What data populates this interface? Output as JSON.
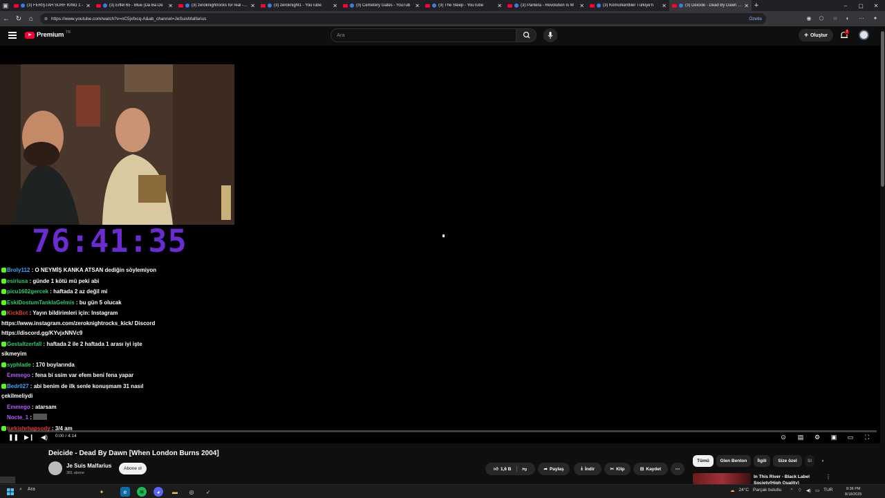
{
  "browser": {
    "tabs": [
      {
        "title": "(3) FERİŞTAH SURF KING 1 -",
        "active": false
      },
      {
        "title": "(3) Eiffel 65 - Blue (Da Ba De",
        "active": false
      },
      {
        "title": "(3) zeroknightrocks for real - You",
        "active": false
      },
      {
        "title": "(3) zeroknight1 - YouTube",
        "active": false
      },
      {
        "title": "(3) Cemetery Gates - YouTub",
        "active": false
      },
      {
        "title": "(3) The Sleep - YouTube",
        "active": false
      },
      {
        "title": "(3) Pantera - Revolution Is M",
        "active": false
      },
      {
        "title": "(3) Kömürkentliler Türkiye'n",
        "active": false
      },
      {
        "title": "(3) Deicide - Dead By Dawn [Whe",
        "active": true
      }
    ],
    "url": "https://www.youtube.com/watch?v=nC5jxfxcq-A&ab_channel=JeSuisMalfarius",
    "summarize_label": "Özetle"
  },
  "youtube": {
    "logo_text": "Premium",
    "logo_country": "TR",
    "search_placeholder": "Ara",
    "create_label": "Oluştur",
    "notification_count": "3"
  },
  "stream": {
    "timer": "76:41:35",
    "chat": [
      {
        "user": "Broly112",
        "color": "#3ea6ff",
        "text": "O NEYMİŞ KANKA ATSAN dediğin söylemiyon"
      },
      {
        "user": "esiriusa",
        "color": "#2ecc71",
        "text": "günde 1 kötü mü peki abi"
      },
      {
        "user": "picu1602gercek",
        "color": "#2ecc71",
        "text": "haftada 2 az değil mi"
      },
      {
        "user": "EskiDostumTanklaGelmis",
        "color": "#2ecc71",
        "text": "bu gün 5 olucak"
      },
      {
        "user": "KickBot",
        "color": "#e53935",
        "text": "Yayın bildirimleri için: Instagram https://www.instagram.com/zeroknightrocks_kick/ Discord https://discord.gg/KYvjxNNVc9"
      },
      {
        "user": "Gestaltzerfall",
        "color": "#2ecc71",
        "text": "haftada 2 ile 2 haftada 1 arası iyi işte sikmeyim"
      },
      {
        "user": "syphlade",
        "color": "#2ecc71",
        "text": "170 boylarında"
      },
      {
        "user": "Emmego",
        "color": "#b05cff",
        "text": "fena bi ssim var efem beni fena yapar"
      },
      {
        "user": "Bedr027",
        "color": "#3ea6ff",
        "text": "abi benim de ilk senle konuşmam 31 nasıl çekilmeliydi"
      },
      {
        "user": "Emmego",
        "color": "#b05cff",
        "text": "atarsam"
      },
      {
        "user": "Nocte_1",
        "color": "#b05cff",
        "text": ""
      },
      {
        "user": "turkishrhapsody",
        "color": "#e53935",
        "text": "3/4 am"
      }
    ]
  },
  "player": {
    "time": "0:00 / 4:14",
    "progress": 0
  },
  "video": {
    "title": "Deicide - Dead By Dawn [When London Burns 2004]",
    "channel": "Je Suis Malfarius",
    "subscribers": "381 abone",
    "subscribe_label": "Abone ol",
    "likes": "1,6 B",
    "share_label": "Paylaş",
    "download_label": "İndir",
    "clip_label": "Klip",
    "save_label": "Kaydet"
  },
  "related": {
    "chips": [
      "Tümü",
      "Glen Benton",
      "İlgili",
      "Size özel",
      "Sl"
    ],
    "first_title": "In This River - Black Label Society(High Quality)"
  },
  "taskbar": {
    "search_label": "Ara",
    "weather": "24°C",
    "weather_text": "Parçak bulutlu",
    "lang": "TUR",
    "time": "8:36 PM",
    "date": "8/18/2025"
  }
}
